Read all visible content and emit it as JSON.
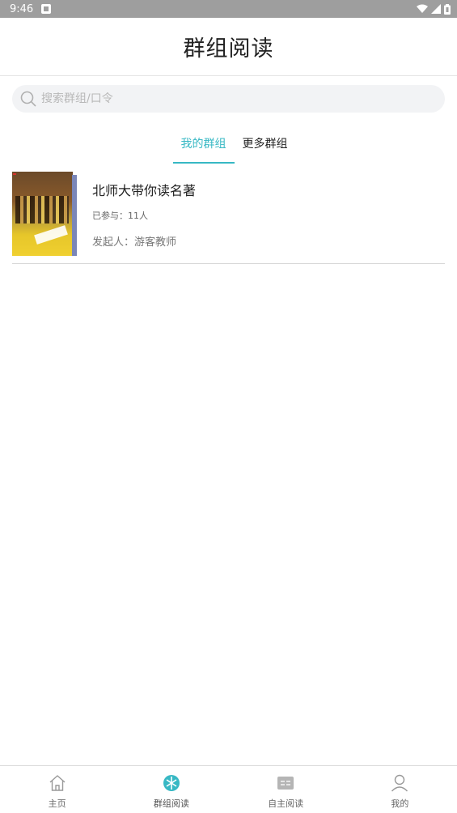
{
  "status_bar": {
    "time": "9:46"
  },
  "header": {
    "title": "群组阅读"
  },
  "search": {
    "placeholder": "搜索群组/口令"
  },
  "tabs": [
    {
      "label": "我的群组",
      "active": true
    },
    {
      "label": "更多群组",
      "active": false
    }
  ],
  "groups": [
    {
      "name": "北师大带你读名著",
      "members": "已参与：11人",
      "founder": "发起人：游客教师"
    }
  ],
  "bottom_nav": [
    {
      "label": "主页",
      "icon": "home-icon"
    },
    {
      "label": "群组阅读",
      "icon": "group-reading-icon",
      "active": true
    },
    {
      "label": "自主阅读",
      "icon": "self-reading-icon"
    },
    {
      "label": "我的",
      "icon": "profile-icon"
    }
  ],
  "colors": {
    "accent": "#37b8c4",
    "status_bar": "#9e9e9e"
  }
}
